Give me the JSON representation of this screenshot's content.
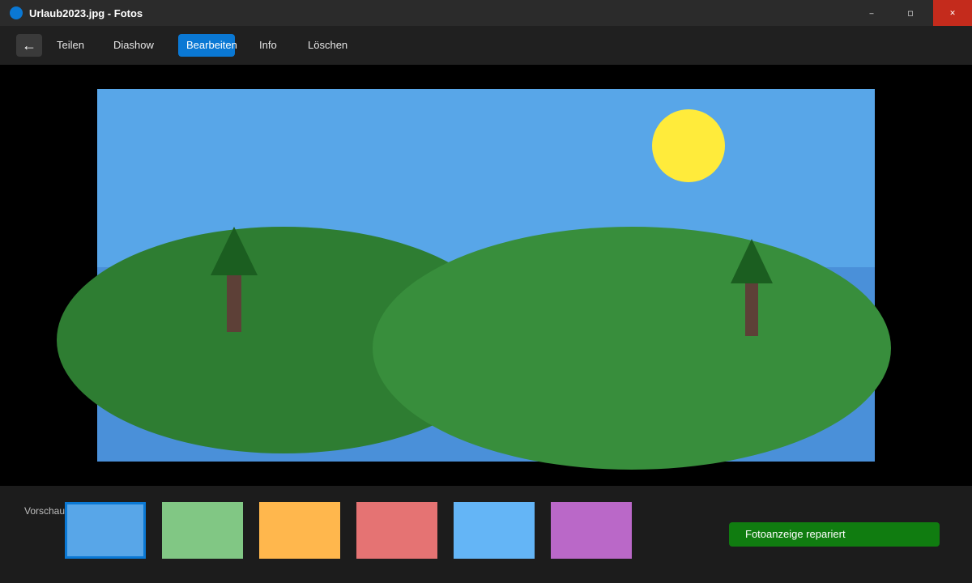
{
  "window": {
    "title": "Urlaub2023.jpg - Fotos",
    "app_icon": "photos-app-icon",
    "controls": {
      "minimize": "–",
      "maximize": "◻",
      "close": "✕"
    }
  },
  "toolbar": {
    "back_icon": "←",
    "items": [
      "Teilen",
      "Diashow",
      "Bearbeiten",
      "Info",
      "Löschen"
    ],
    "active_item": "Bearbeiten"
  },
  "filmstrip": {
    "label": "Vorschau",
    "thumbnails": [
      {
        "color": "#58a6e8",
        "selected": true
      },
      {
        "color": "#81c784",
        "selected": false
      },
      {
        "color": "#ffb74d",
        "selected": false
      },
      {
        "color": "#e57373",
        "selected": false
      },
      {
        "color": "#64b5f6",
        "selected": false
      },
      {
        "color": "#ba68c8",
        "selected": false
      }
    ]
  },
  "notification": {
    "text": "Fotoanzeige repariert"
  },
  "colors": {
    "accent": "#0a78d4",
    "success": "#107c10",
    "close": "#c42b1c"
  }
}
